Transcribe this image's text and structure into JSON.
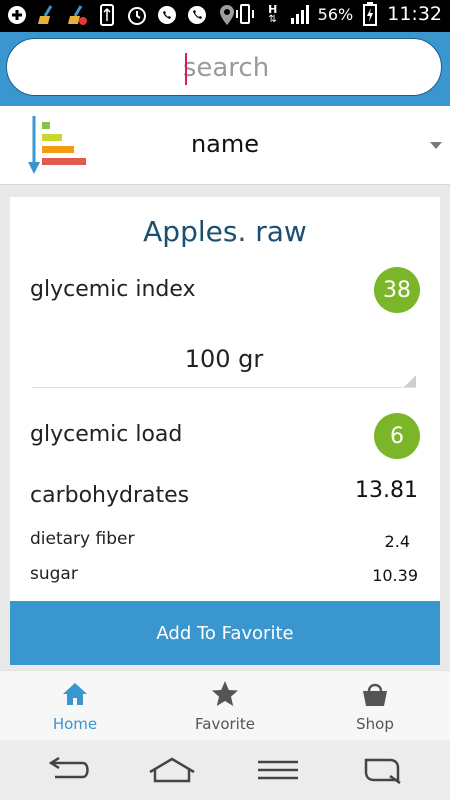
{
  "status_bar": {
    "battery_percent": "56%",
    "time": "11:32",
    "network_type": "H",
    "icons": [
      "plus-icon",
      "broom-icon",
      "broom-alert-icon",
      "usb-icon",
      "alarm-icon",
      "whatsapp-icon",
      "phone-icon",
      "location-icon",
      "vibrate-icon",
      "data-arrows-icon",
      "signal-icon",
      "battery-charging-icon"
    ]
  },
  "search": {
    "placeholder": "search",
    "value": ""
  },
  "sort": {
    "label": "name",
    "icon": "sort-bars-icon"
  },
  "food": {
    "name": "Apples. raw",
    "glycemic_index_label": "glycemic index",
    "glycemic_index": "38",
    "quantity": "100 gr",
    "glycemic_load_label": "glycemic load",
    "glycemic_load": "6",
    "carbohydrates_label": "carbohydrates",
    "carbohydrates": "13.81",
    "dietary_fiber_label": "dietary fiber",
    "dietary_fiber": "2.4",
    "sugar_label": "sugar",
    "sugar": "10.39"
  },
  "actions": {
    "add_to_favorite": "Add To Favorite"
  },
  "bottom_nav": {
    "items": [
      {
        "label": "Home",
        "icon": "home-icon",
        "active": true
      },
      {
        "label": "Favorite",
        "icon": "star-icon",
        "active": false
      },
      {
        "label": "Shop",
        "icon": "shopping-basket-icon",
        "active": false
      }
    ]
  },
  "system_nav": {
    "icons": [
      "back-icon",
      "home-outline-icon",
      "menu-icon",
      "recent-apps-icon"
    ]
  },
  "colors": {
    "primary": "#3a96cf",
    "badge_green": "#7ab52a",
    "title_blue": "#1b4f72",
    "caret_pink": "#d81b60"
  }
}
